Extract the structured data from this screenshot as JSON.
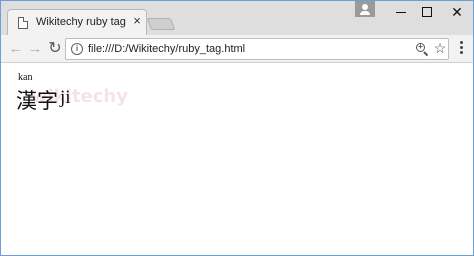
{
  "browser": {
    "tab": {
      "title": "Wikitechy ruby tag",
      "close_glyph": "×",
      "icon": "document-icon"
    },
    "window_controls": {
      "profile_icon": "user-icon",
      "minimize_icon": "minimize-icon",
      "maximize_icon": "maximize-icon",
      "close_glyph": "✕"
    },
    "toolbar": {
      "back_glyph": "←",
      "forward_glyph": "→",
      "reload_glyph": "↻",
      "info_glyph": "i",
      "url": "file:///D:/Wikitechy/ruby_tag.html",
      "star_glyph": "☆",
      "zoom_glyph": "+"
    }
  },
  "page": {
    "ruby_annotation": "kan",
    "ruby_base": "漢字",
    "trailing_text": "ji",
    "watermark": "wikitechy"
  },
  "colors": {
    "tabstrip": "#dedede",
    "toolbar": "#f2f2f2",
    "window_border": "#6aa0d8",
    "watermark": "#f3d6e0"
  }
}
